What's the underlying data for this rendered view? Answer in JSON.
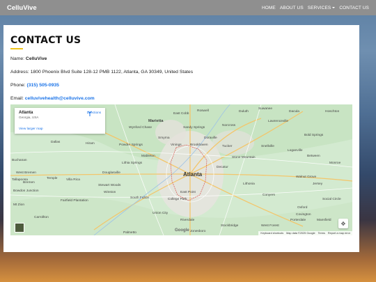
{
  "navbar": {
    "brand": "CelluVive",
    "links": [
      "HOME",
      "ABOUT US",
      "SERVICES",
      "CONTACT US"
    ]
  },
  "contact": {
    "title": "CONTACT US",
    "name_label": "Name: ",
    "name_value": "CelluVive",
    "address_label": "Address: ",
    "address_value": "1800 Phoenix Blvd Suite 128-12 PMB 1122, Atlanta, GA 30349, United States",
    "phone_label": "Phone: ",
    "phone_value": "(315) 505-0935",
    "email_label": "Email: ",
    "email_value": "celluvivehealth@celluvive.com"
  },
  "map": {
    "infobox": {
      "title": "Atlanta",
      "subtitle": "Georgia, USA",
      "view_larger": "View larger map",
      "directions": "Directions"
    },
    "labels": {
      "atlanta": "Atlanta",
      "marietta": "Marietta",
      "east_cobb": "East Cobb",
      "sandy_springs": "Sandy Springs",
      "roswell": "Roswell",
      "duluth": "Duluth",
      "suwanee": "Suwanee",
      "dacula": "Dacula",
      "hoschton": "Hoschton",
      "lawrenceville": "Lawrenceville",
      "norcross": "Norcross",
      "doraville": "Doraville",
      "tucker": "Tucker",
      "smyrna": "Smyrna",
      "vinings": "Vinings",
      "brookhaven": "Brookhaven",
      "wynford_chase": "Wynford Chase",
      "powder_springs": "Powder Springs",
      "hiram": "Hiram",
      "dallas": "Dallas",
      "mableton": "Mableton",
      "lithia_springs": "Lithia Springs",
      "douglasville": "Douglasville",
      "decatur": "Decatur",
      "stone_mountain": "Stone Mountain",
      "snellville": "Snellville",
      "loganville": "Loganville",
      "bold_springs": "Bold Springs",
      "between": "Between",
      "monroe": "Monroe",
      "walnut_grove": "Walnut Grove",
      "jersey": "Jersey",
      "lithonia": "Lithonia",
      "conyers": "Conyers",
      "east_point": "East Point",
      "college_park": "College Park",
      "south_fulton": "South Fulton",
      "stewart_woods": "Stewart Woods",
      "winston": "Winston",
      "villa_rica": "Villa Rica",
      "temple": "Temple",
      "west_bremen": "West Bremen",
      "bremen": "Bremen",
      "bowdon_junction": "Bowdon Junction",
      "mt_zion": "Mt Zion",
      "fairfield_plantation": "Fairfield Plantation",
      "union_city": "Union City",
      "riverdale": "Riverdale",
      "stockbridge": "Stockbridge",
      "west_forest": "West Forest",
      "covington": "Covington",
      "porterdale": "Porterdale",
      "oxford": "Oxford",
      "social_circle": "Social Circle",
      "mansfield": "Mansfield",
      "palmetto": "Palmetto",
      "jonesboro": "Jonesboro",
      "carrollton": "Carrollton",
      "buchanan": "Buchanan",
      "tallapoosa": "Tallapoosa"
    },
    "attribution": [
      "Keyboard shortcuts",
      "Map data ©2025 Google",
      "Terms",
      "Report a map error"
    ],
    "google": "Google"
  }
}
